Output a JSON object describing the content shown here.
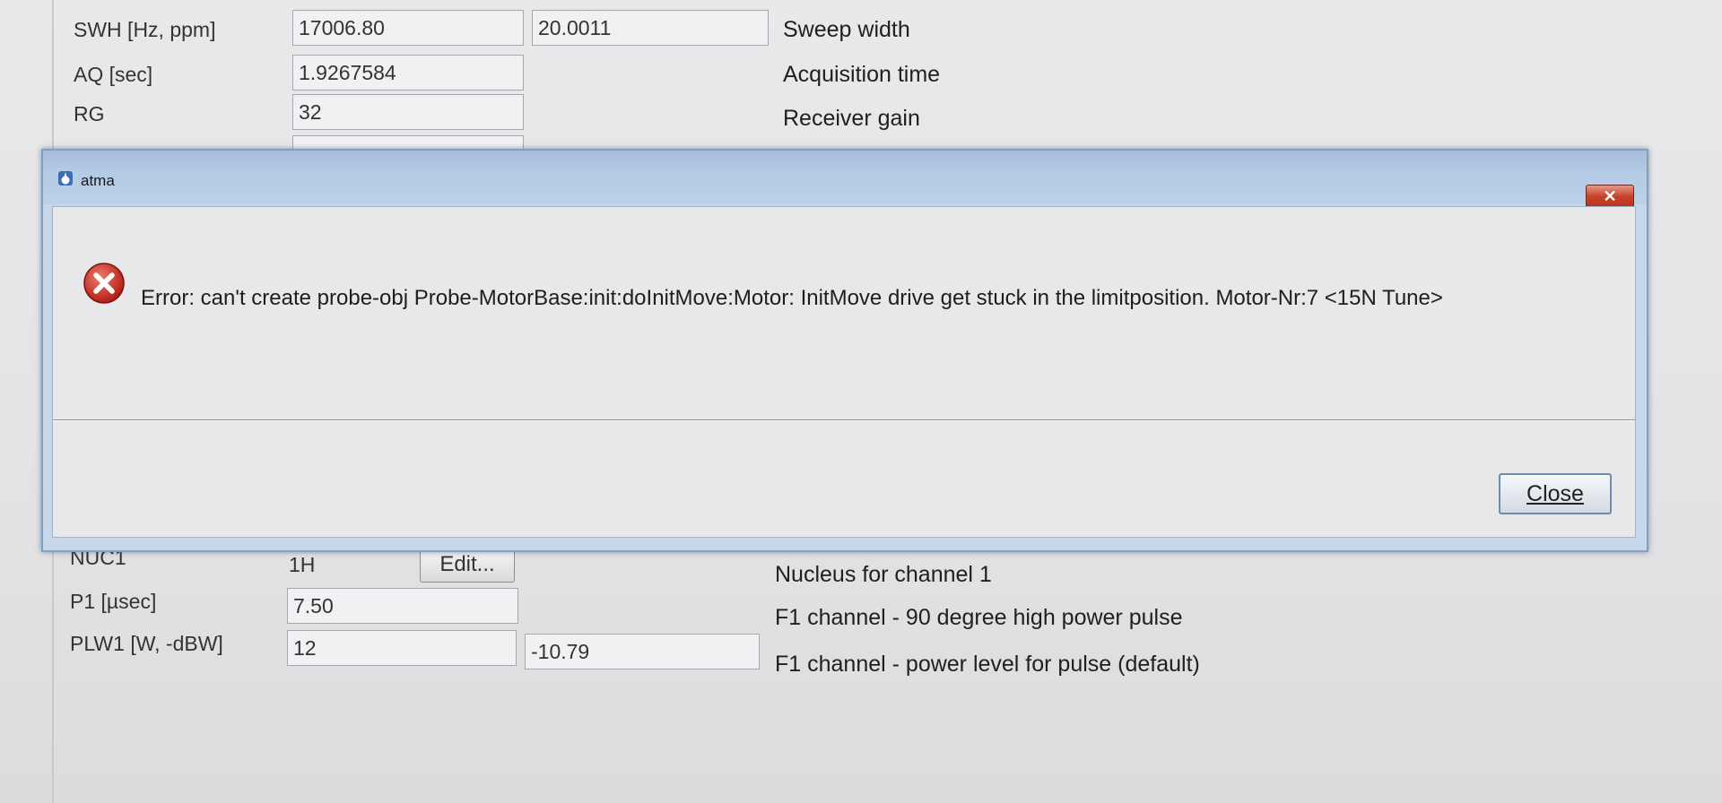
{
  "params_top": [
    {
      "label": "SWH [Hz, ppm]",
      "value1": "17006.80",
      "value2": "20.0011",
      "description": "Sweep width"
    },
    {
      "label": "AQ [sec]",
      "value1": "1.9267584",
      "description": "Acquisition time"
    },
    {
      "label": "RG",
      "value1": "32",
      "description": "Receiver gain"
    }
  ],
  "params_bottom": [
    {
      "label": "NUC1",
      "value1": "1H",
      "button": "Edit...",
      "description": "Nucleus for channel 1"
    },
    {
      "label": "P1 [µsec]",
      "value1": "7.50",
      "description": "F1 channel -  90 degree high power pulse"
    },
    {
      "label": "PLW1 [W, -dBW]",
      "value1": "12",
      "value2": "-10.79",
      "description": "F1 channel - power level for pulse (default)"
    }
  ],
  "dialog": {
    "title": "atma",
    "close_x": "✕",
    "message": "Error: can't create probe-obj Probe-MotorBase:init:doInitMove:Motor: InitMove drive get stuck in the limitposition. Motor-Nr:7 <15N Tune>",
    "close_button": "Close"
  },
  "icons": {
    "error": "error-x-circle-icon",
    "app": "app-icon"
  },
  "colors": {
    "error_red": "#c8281f",
    "dialog_frame": "#c6d7ea",
    "titlebar": "#b4cbe5"
  }
}
